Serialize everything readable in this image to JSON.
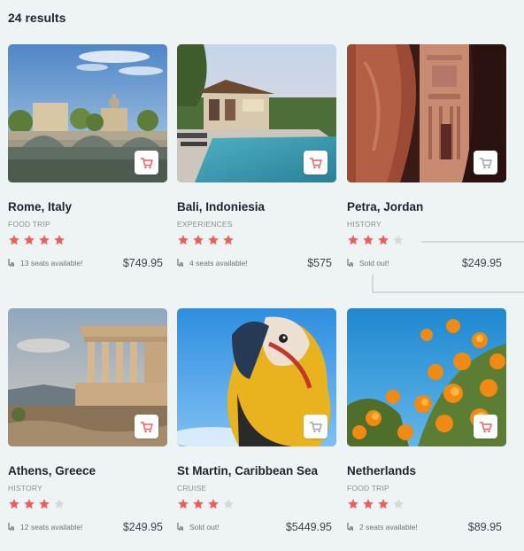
{
  "results_label": "24 results",
  "colors": {
    "star_filled": "#ef5b5b",
    "star_empty": "#d5d8dc",
    "cart_icon": "#ef5b5b"
  },
  "cards": [
    {
      "title": "Rome, Italy",
      "category": "FOOD TRIP",
      "rating": 4,
      "seats": "13 seats available!",
      "price": "$749.95",
      "image": "rome-bridge"
    },
    {
      "title": "Bali, Indoniesia",
      "category": "EXPERIENCES",
      "rating": 4,
      "seats": "4 seats available!",
      "price": "$575",
      "image": "bali-pool-villa"
    },
    {
      "title": "Petra, Jordan",
      "category": "HISTORY",
      "rating": 3,
      "seats": "Sold out!",
      "price": "$249.95",
      "image": "petra-treasury"
    },
    {
      "title": "Athens, Greece",
      "category": "HISTORY",
      "rating": 3,
      "seats": "12 seats available!",
      "price": "$249.95",
      "image": "athens-temple"
    },
    {
      "title": "St Martin, Caribbean Sea",
      "category": "CRUISE",
      "rating": 3,
      "seats": "Sold out!",
      "price": "$5449.95",
      "image": "macaw-parrot"
    },
    {
      "title": "Netherlands",
      "category": "FOOD TRIP",
      "rating": 3,
      "seats": "2 seats available!",
      "price": "$89.95",
      "image": "orange-flowers"
    }
  ]
}
